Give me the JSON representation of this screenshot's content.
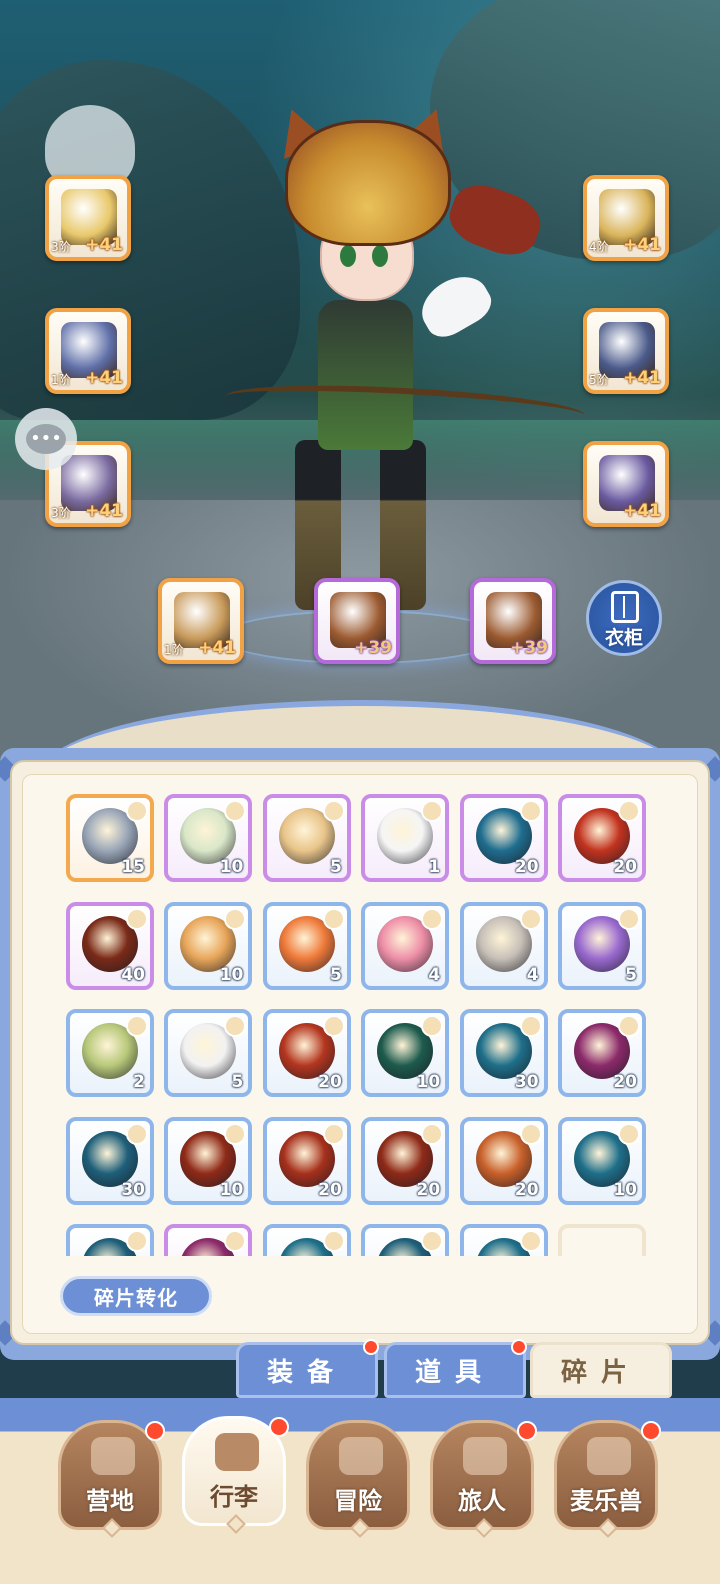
{
  "equipment": {
    "left": [
      {
        "name": "bow",
        "tier": "3阶",
        "level": "+41",
        "icon_color": "#e8c86a"
      },
      {
        "name": "armor",
        "tier": "1阶",
        "level": "+41",
        "icon_color": "#5f6fa8"
      },
      {
        "name": "pants",
        "tier": "3阶",
        "level": "+41",
        "icon_color": "#7a6aa0"
      }
    ],
    "right": [
      {
        "name": "helmet",
        "tier": "4阶",
        "level": "+41",
        "icon_color": "#d9b45a"
      },
      {
        "name": "gloves",
        "tier": "5阶",
        "level": "+41",
        "icon_color": "#4a5a8a"
      },
      {
        "name": "boots",
        "tier": "",
        "level": "+41",
        "icon_color": "#6a5aa0"
      }
    ],
    "bottom": [
      {
        "name": "ring",
        "tier": "1阶",
        "level": "+41",
        "icon_color": "#c89a5a"
      },
      {
        "name": "necklace",
        "tier": "",
        "level": "+39",
        "icon_color": "#9b5a30"
      },
      {
        "name": "amulet",
        "tier": "",
        "level": "+39",
        "icon_color": "#9b5a30"
      }
    ]
  },
  "wardrobe_label": "衣柜",
  "fragments": [
    {
      "count": "15",
      "rarity": "orange",
      "color": "#9aa7b8"
    },
    {
      "count": "10",
      "rarity": "purple",
      "color": "#d9e7c8"
    },
    {
      "count": "5",
      "rarity": "purple",
      "color": "#e9c58a"
    },
    {
      "count": "1",
      "rarity": "purple",
      "color": "#f5f5f5"
    },
    {
      "count": "20",
      "rarity": "purple",
      "color": "#1f6d8f"
    },
    {
      "count": "20",
      "rarity": "purple",
      "color": "#c2331f"
    },
    {
      "count": "40",
      "rarity": "purple",
      "color": "#7a2a18"
    },
    {
      "count": "10",
      "rarity": "blue",
      "color": "#e8a65a"
    },
    {
      "count": "5",
      "rarity": "blue",
      "color": "#ef7a3a"
    },
    {
      "count": "4",
      "rarity": "blue",
      "color": "#ee8fa8"
    },
    {
      "count": "4",
      "rarity": "blue",
      "color": "#c7c0b8"
    },
    {
      "count": "5",
      "rarity": "blue",
      "color": "#9a6ad0"
    },
    {
      "count": "2",
      "rarity": "blue",
      "color": "#b8c97a"
    },
    {
      "count": "5",
      "rarity": "blue",
      "color": "#f2f2f2"
    },
    {
      "count": "20",
      "rarity": "blue",
      "color": "#b4361f"
    },
    {
      "count": "10",
      "rarity": "blue",
      "color": "#1d5b4d"
    },
    {
      "count": "30",
      "rarity": "blue",
      "color": "#1e6f8a"
    },
    {
      "count": "20",
      "rarity": "blue",
      "color": "#8c2a6a"
    },
    {
      "count": "30",
      "rarity": "blue",
      "color": "#1e5f7a"
    },
    {
      "count": "10",
      "rarity": "blue",
      "color": "#8f2a18"
    },
    {
      "count": "20",
      "rarity": "blue",
      "color": "#a6301c"
    },
    {
      "count": "20",
      "rarity": "blue",
      "color": "#8f2a18"
    },
    {
      "count": "20",
      "rarity": "blue",
      "color": "#c8602a"
    },
    {
      "count": "10",
      "rarity": "blue",
      "color": "#1e6f8a"
    },
    {
      "count": "",
      "rarity": "blue",
      "color": "#1e5f7a"
    },
    {
      "count": "",
      "rarity": "purple",
      "color": "#8c2a6a"
    },
    {
      "count": "",
      "rarity": "blue",
      "color": "#1e6f8a"
    },
    {
      "count": "",
      "rarity": "blue",
      "color": "#1e5f7a"
    },
    {
      "count": "",
      "rarity": "blue",
      "color": "#1e6f8a"
    },
    {
      "count": "",
      "rarity": "empty",
      "color": ""
    }
  ],
  "convert_button": "碎片转化",
  "tabs": [
    {
      "label": "装备",
      "active": false,
      "badge": true
    },
    {
      "label": "道具",
      "active": false,
      "badge": true
    },
    {
      "label": "碎片",
      "active": true,
      "badge": false
    }
  ],
  "nav": [
    {
      "label": "营地",
      "active": false,
      "badge": true,
      "icon": "castle-icon"
    },
    {
      "label": "行李",
      "active": true,
      "badge": true,
      "icon": "chest-icon"
    },
    {
      "label": "冒险",
      "active": false,
      "badge": false,
      "icon": "crossed-swords-icon"
    },
    {
      "label": "旅人",
      "active": false,
      "badge": true,
      "icon": "traveler-icon"
    },
    {
      "label": "麦乐兽",
      "active": false,
      "badge": true,
      "icon": "cat-icon"
    }
  ]
}
